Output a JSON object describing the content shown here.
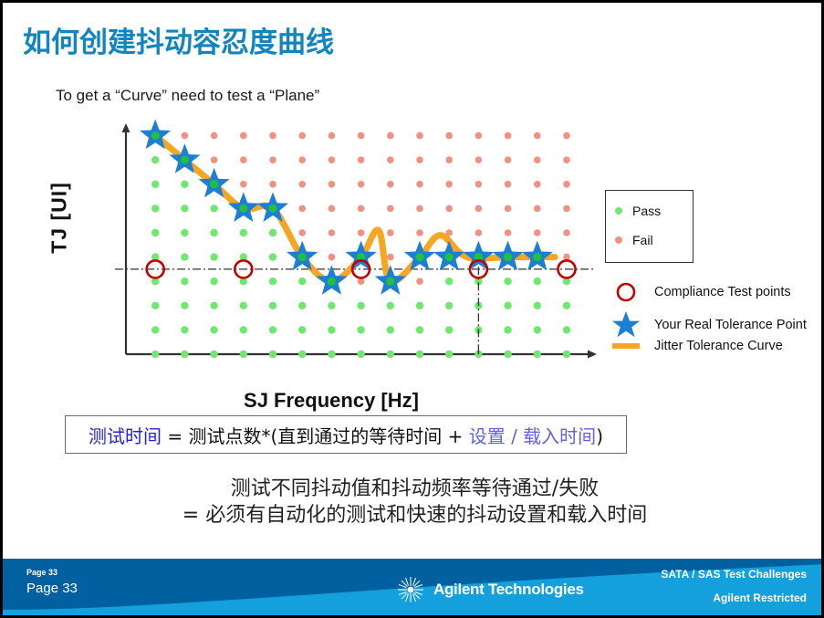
{
  "slide": {
    "title": "如何创建抖动容忍度曲线",
    "subtitle": "To get a “Curve” need to test a “Plane”",
    "title_color": "#1285BE"
  },
  "chart_data": {
    "type": "scatter",
    "title": "",
    "xlabel": "SJ Frequency [Hz]",
    "ylabel": "TJ [UI]",
    "xlim": [
      0,
      15
    ],
    "ylim": [
      0,
      10
    ],
    "grid": true,
    "legend_position": "right",
    "colors": {
      "pass": "#6EE86E",
      "fail": "#F29182",
      "curve": "#F5A623",
      "star_fill": "#1C7FD6",
      "star_inner": "#22C03C",
      "compliance_circle": "#C00000",
      "axis": "#333333"
    },
    "grid_columns": 15,
    "grid_rows": 10,
    "note": "Pass/Fail plane: green dots below the tolerance boundary are Pass, salmon dots above are Fail.",
    "boundary_row_by_column": [
      9,
      8,
      7,
      6,
      6,
      5,
      4,
      3,
      4,
      3,
      4,
      4,
      4,
      4,
      4
    ],
    "series": [
      {
        "name": "Your Real Tolerance Point",
        "marker": "star",
        "points": [
          {
            "col": 1,
            "row": 9
          },
          {
            "col": 2,
            "row": 8
          },
          {
            "col": 3,
            "row": 7
          },
          {
            "col": 4,
            "row": 6
          },
          {
            "col": 5,
            "row": 6
          },
          {
            "col": 6,
            "row": 4
          },
          {
            "col": 7,
            "row": 3
          },
          {
            "col": 8,
            "row": 4
          },
          {
            "col": 9,
            "row": 3
          },
          {
            "col": 10,
            "row": 4
          },
          {
            "col": 11,
            "row": 4
          },
          {
            "col": 12,
            "row": 4
          },
          {
            "col": 13,
            "row": 4
          },
          {
            "col": 14,
            "row": 4
          }
        ]
      },
      {
        "name": "Compliance Test points",
        "marker": "circle",
        "points": [
          {
            "col": 1,
            "row": 3.5
          },
          {
            "col": 4,
            "row": 3.5
          },
          {
            "col": 8,
            "row": 3.5
          },
          {
            "col": 12,
            "row": 3.5
          },
          {
            "col": 15,
            "row": 3.5
          }
        ]
      },
      {
        "name": "Jitter Tolerance Curve",
        "marker": "line",
        "points": [
          {
            "col": 1,
            "row": 9
          },
          {
            "col": 2,
            "row": 8
          },
          {
            "col": 3,
            "row": 7
          },
          {
            "col": 4,
            "row": 6
          },
          {
            "col": 5,
            "row": 6
          },
          {
            "col": 6,
            "row": 4
          },
          {
            "col": 7,
            "row": 3
          },
          {
            "col": 8,
            "row": 4
          },
          {
            "col": 8.6,
            "row": 5.1
          },
          {
            "col": 9,
            "row": 3
          },
          {
            "col": 10,
            "row": 4
          },
          {
            "col": 10.7,
            "row": 4.9
          },
          {
            "col": 11.6,
            "row": 4
          },
          {
            "col": 13,
            "row": 4
          },
          {
            "col": 14.6,
            "row": 4
          }
        ]
      }
    ],
    "reference_lines": [
      {
        "orientation": "horizontal",
        "row": 3.5,
        "style": "dash-dot"
      },
      {
        "orientation": "vertical",
        "col": 12,
        "style": "dash-dot"
      }
    ]
  },
  "pass_fail_legend": {
    "items": [
      {
        "label": "Pass",
        "color": "#6EE86E",
        "icon": "green-dot-icon"
      },
      {
        "label": "Fail",
        "color": "#F29182",
        "icon": "salmon-dot-icon"
      }
    ]
  },
  "side_legend": {
    "items": [
      {
        "label": "Compliance Test points",
        "icon": "red-circle-icon"
      },
      {
        "label": "Your Real Tolerance Point",
        "icon": "blue-star-icon"
      },
      {
        "label": "Jitter Tolerance Curve",
        "icon": "orange-line-icon"
      }
    ]
  },
  "formula": {
    "part1": "测试时间",
    "part2": " = 测试点数*(直到通过的等待时间 + ",
    "part3": "设置 / 载入时间",
    "part4": ")"
  },
  "conclusion": {
    "line1": "测试不同抖动值和抖动频率等待通过/失败",
    "line2": "= 必须有自动化的测试和快速的抖动设置和载入时间"
  },
  "footer": {
    "page_small": "Page 33",
    "page_big": "Page 33",
    "brand": "Agilent Technologies",
    "right_top": "SATA / SAS Test Challenges",
    "right_bottom": "Agilent Restricted"
  }
}
